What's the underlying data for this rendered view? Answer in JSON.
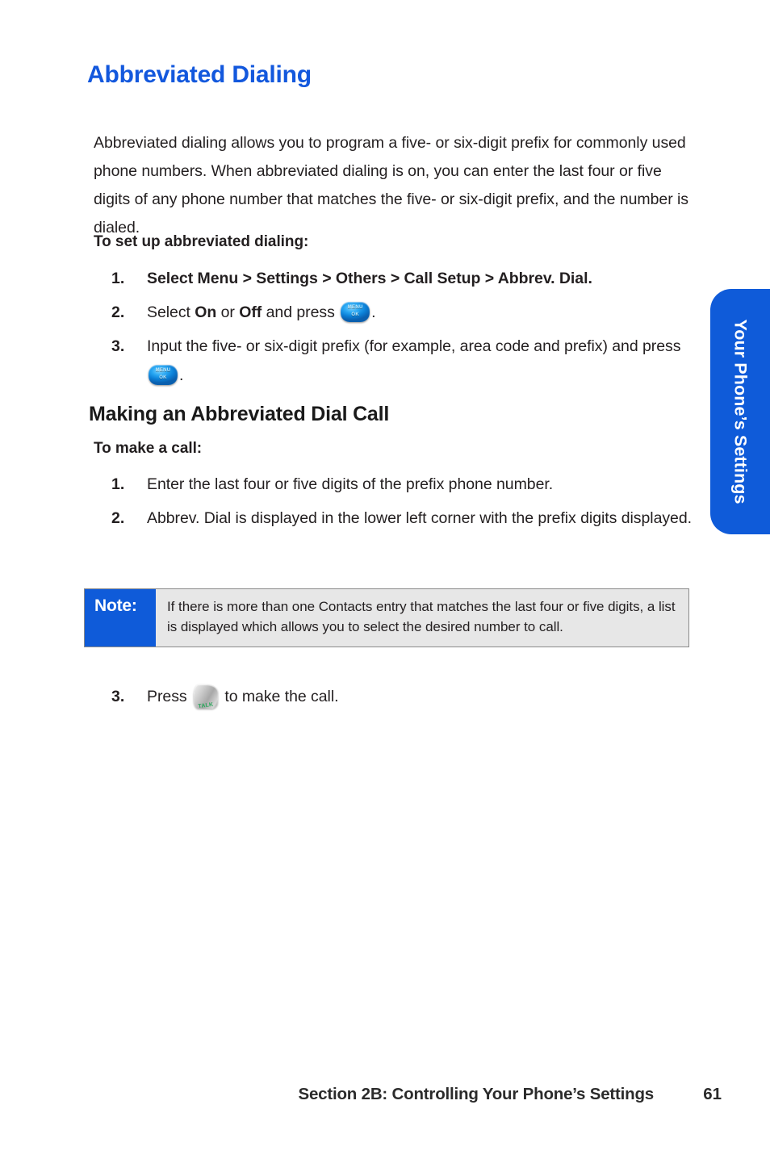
{
  "page": {
    "title": "Abbreviated Dialing",
    "intro": "Abbreviated dialing allows you to program a five- or six-digit prefix for commonly used phone numbers. When abbreviated dialing is on, you can enter the last four or five digits of any phone number that matches the five- or six-digit prefix, and the number is dialed.",
    "subheading": "Making an Abbreviated Dial Call"
  },
  "setup": {
    "lead": "To set up abbreviated dialing:",
    "items": [
      {
        "num": "1.",
        "text": "Select Menu > Settings > Others > Call Setup > Abbrev. Dial."
      },
      {
        "num": "2.",
        "pre": "Select ",
        "bold1": "On",
        "mid": " or ",
        "bold2": "Off",
        "post": " and press ",
        "tail": "."
      },
      {
        "num": "3.",
        "pre": "Input the five- or six-digit prefix (for example, area code and prefix) and press ",
        "tail": "."
      }
    ]
  },
  "makecall": {
    "lead": "To make a call:",
    "items": [
      {
        "num": "1.",
        "text": "Enter the last four or five digits of the prefix phone number."
      },
      {
        "num": "2.",
        "text": "Abbrev. Dial is displayed in the lower left corner with the prefix digits displayed."
      }
    ],
    "item3": {
      "num": "3.",
      "pre": "Press ",
      "post": " to make the call."
    }
  },
  "note": {
    "label": "Note:",
    "text": "If there is more than one Contacts entry that matches the last four or five digits, a list is displayed which allows you to select the desired number to call."
  },
  "side_tab": {
    "label": "Your Phone’s Settings"
  },
  "footer": {
    "section": "Section 2B: Controlling Your Phone’s Settings",
    "page_number": "61"
  },
  "icons": {
    "menu_key": {
      "name": "menu-ok-key-icon",
      "line1": "MENU",
      "line2": "OK"
    },
    "talk_key": {
      "name": "talk-key-icon",
      "label": "TALK"
    }
  },
  "colors": {
    "heading_blue": "#1358dd",
    "tab_blue": "#0f5bd9",
    "note_bg": "#e7e7e7",
    "note_border": "#8a8a8a",
    "text": "#231f20"
  }
}
